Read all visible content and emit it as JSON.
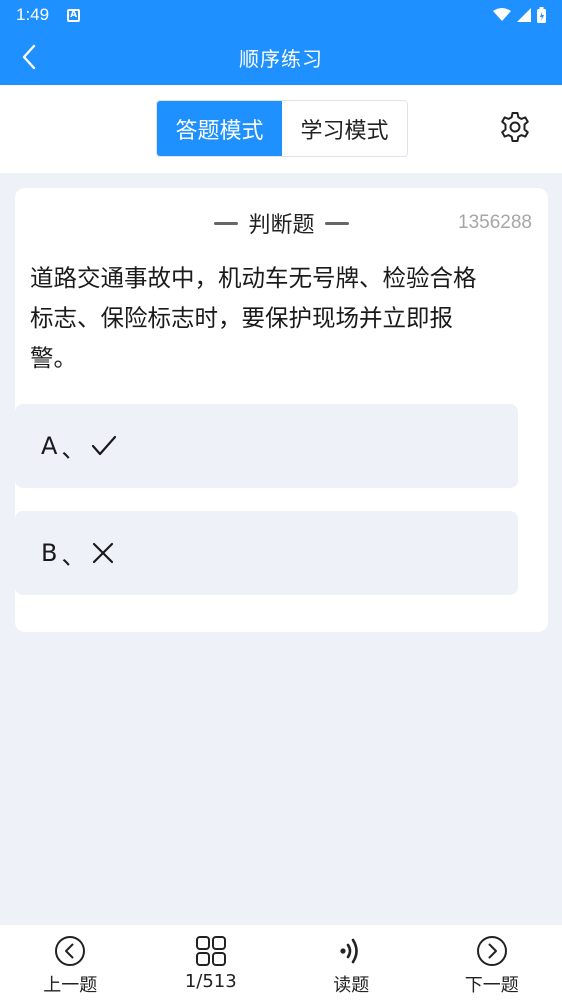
{
  "status_bar": {
    "time": "1:49",
    "notification_icon": "a-icon"
  },
  "header": {
    "title": "顺序练习",
    "back_icon": "chevron-left-icon"
  },
  "mode_toggle": {
    "options": [
      "答题模式",
      "学习模式"
    ],
    "active": "答题模式"
  },
  "settings_icon": "gear-icon",
  "question": {
    "type": "判断题",
    "id": "1356288",
    "text": "道路交通事故中，机动车无号牌、检验合格标志、保险标志时，要保护现场并立即报警。",
    "text_lines": [
      "道路交通事故中，机动车无号牌、检验合格",
      "标志、保险标志时，要保护现场并立即报",
      "警。"
    ],
    "options": [
      {
        "letter": "A",
        "sep": "、",
        "icon": "check-icon"
      },
      {
        "letter": "B",
        "sep": "、",
        "icon": "cross-icon"
      }
    ]
  },
  "bottom_nav": {
    "prev_label": "上一题",
    "progress_label": "1/513",
    "read_label": "读题",
    "next_label": "下一题"
  },
  "colors": {
    "primary": "#1e90ff",
    "page_bg": "#eef1f7",
    "option_bg": "#eef1f7"
  }
}
